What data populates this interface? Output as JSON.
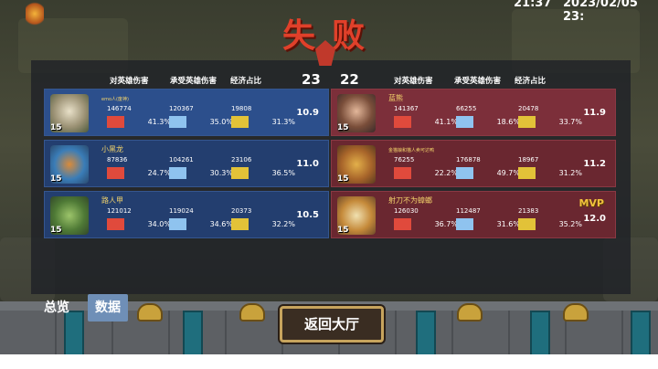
{
  "header": {
    "title": "失败",
    "clock": "21:37",
    "date": "2023/02/05 23:"
  },
  "scores": {
    "left": "23",
    "right": "22"
  },
  "columns": [
    "对英雄伤害",
    "承受英雄伤害",
    "经济占比"
  ],
  "colors": {
    "red_bar": "#e04a3c",
    "blue_bar": "#8fc3ef",
    "yellow_bar": "#e2c238",
    "title": "#e0402a",
    "name": "#f2d36b",
    "mvp": "#f0c23c"
  },
  "left_team": [
    {
      "name": "emo人(废神)",
      "level": "15",
      "dmg": "146774",
      "dmg_pct": "41.3%",
      "taken": "120367",
      "taken_pct": "35.0%",
      "econ": "19808",
      "econ_pct": "31.3%",
      "rating": "10.9"
    },
    {
      "name": "小黑龙",
      "level": "15",
      "dmg": "87836",
      "dmg_pct": "24.7%",
      "taken": "104261",
      "taken_pct": "30.3%",
      "econ": "23106",
      "econ_pct": "36.5%",
      "rating": "11.0"
    },
    {
      "name": "路人甲",
      "level": "15",
      "dmg": "121012",
      "dmg_pct": "34.0%",
      "taken": "119024",
      "taken_pct": "34.6%",
      "econ": "20373",
      "econ_pct": "32.2%",
      "rating": "10.5"
    }
  ],
  "right_team": [
    {
      "name": "蓝熊",
      "level": "15",
      "dmg": "141367",
      "dmg_pct": "41.1%",
      "taken": "66255",
      "taken_pct": "18.6%",
      "econ": "20478",
      "econ_pct": "33.7%",
      "rating": "11.9"
    },
    {
      "name": "金猫娘和猫人卖可达鸭",
      "level": "15",
      "dmg": "76255",
      "dmg_pct": "22.2%",
      "taken": "176878",
      "taken_pct": "49.7%",
      "econ": "18967",
      "econ_pct": "31.2%",
      "rating": "11.2"
    },
    {
      "name": "射刀不为蟑螂",
      "level": "15",
      "dmg": "126030",
      "dmg_pct": "36.7%",
      "taken": "112487",
      "taken_pct": "31.6%",
      "econ": "21383",
      "econ_pct": "35.2%",
      "rating": "12.0",
      "badge": "MVP"
    }
  ],
  "tabs": {
    "overview": "总览",
    "data": "数据"
  },
  "return_button": "返回大厅"
}
